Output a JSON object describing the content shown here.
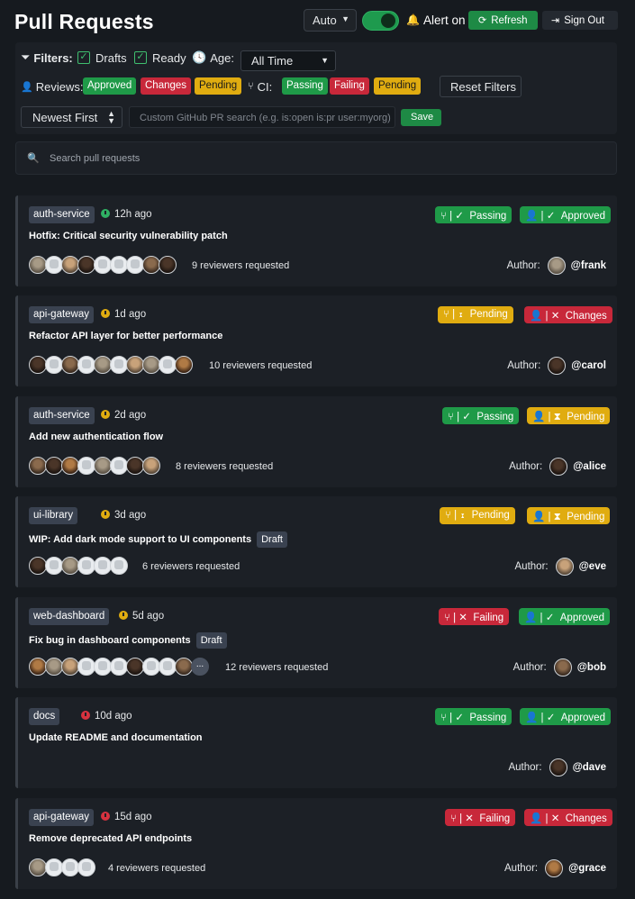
{
  "header": {
    "title": "Pull Requests",
    "theme": "Auto",
    "alert_label": "Alert on",
    "refresh_label": "Refresh",
    "signout_label": "Sign Out"
  },
  "filters": {
    "label": "Filters:",
    "drafts_label": "Drafts",
    "ready_label": "Ready",
    "age_label": "Age:",
    "age_value": "All Time",
    "reviews_label": "Reviews:",
    "reviews": [
      "Approved",
      "Changes",
      "Pending"
    ],
    "ci_label": "CI:",
    "ci": [
      "Passing",
      "Failing",
      "Pending"
    ],
    "reset_label": "Reset Filters",
    "sort_value": "Newest First",
    "custom_placeholder": "Custom GitHub PR search (e.g. is:open is:pr user:myorg)",
    "save_label": "Save"
  },
  "search": {
    "placeholder": "Search pull requests"
  },
  "author_label": "Author:",
  "prs": [
    {
      "repo": "auth-service",
      "age": "12h ago",
      "age_color": "green",
      "title": "Hotfix: Critical security vulnerability patch",
      "draft": false,
      "ci": "Passing",
      "review": "Approved",
      "reviewers_text": "9 reviewers requested",
      "author": "@frank"
    },
    {
      "repo": "api-gateway",
      "age": "1d ago",
      "age_color": "yellow",
      "title": "Refactor API layer for better performance",
      "draft": false,
      "ci": "Pending",
      "review": "Changes",
      "reviewers_text": "10 reviewers requested",
      "author": "@carol"
    },
    {
      "repo": "auth-service",
      "age": "2d ago",
      "age_color": "yellow",
      "title": "Add new authentication flow",
      "draft": false,
      "ci": "Passing",
      "review": "Pending",
      "reviewers_text": "8 reviewers requested",
      "author": "@alice"
    },
    {
      "repo": "ui-library",
      "age": "3d ago",
      "age_color": "yellow",
      "title": "WIP: Add dark mode support to UI components",
      "draft": true,
      "draft_label": "Draft",
      "ci": "Pending",
      "review": "Pending",
      "reviewers_text": "6 reviewers requested",
      "author": "@eve"
    },
    {
      "repo": "web-dashboard",
      "age": "5d ago",
      "age_color": "yellow",
      "title": "Fix bug in dashboard components",
      "draft": true,
      "draft_label": "Draft",
      "ci": "Failing",
      "review": "Approved",
      "reviewers_text": "12 reviewers requested",
      "more": "...",
      "author": "@bob"
    },
    {
      "repo": "docs",
      "age": "10d ago",
      "age_color": "red",
      "title": "Update README and documentation",
      "draft": false,
      "ci": "Passing",
      "review": "Approved",
      "reviewers_text": "",
      "author": "@dave"
    },
    {
      "repo": "api-gateway",
      "age": "15d ago",
      "age_color": "red",
      "title": "Remove deprecated API endpoints",
      "draft": false,
      "ci": "Failing",
      "review": "Changes",
      "reviewers_text": "4 reviewers requested",
      "author": "@grace"
    }
  ],
  "colors": {
    "green": "#1f9a48",
    "red": "#c8283a",
    "yellow": "#e0ac10",
    "accent": "#1e8a45"
  }
}
